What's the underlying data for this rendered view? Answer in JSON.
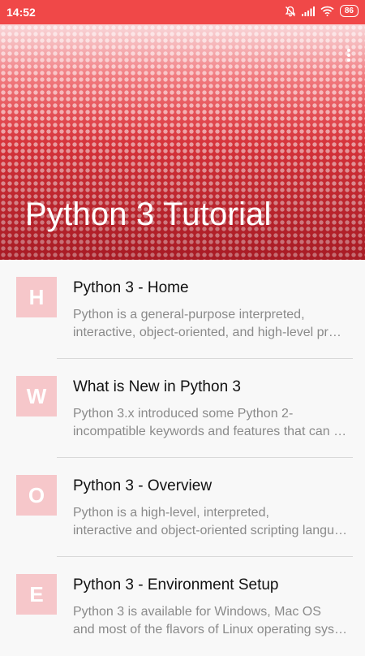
{
  "status_bar": {
    "time": "14:52",
    "battery": "86"
  },
  "header": {
    "title": "Python 3 Tutorial"
  },
  "items": [
    {
      "letter": "H",
      "title": "Python 3 - Home",
      "line1": "Python is a general-purpose interpreted,",
      "line2": "interactive, object-oriented, and high-level programming language."
    },
    {
      "letter": "W",
      "title": "What is New in Python 3",
      "line1": "Python 3.x introduced some Python 2-",
      "line2": "incompatible keywords and features that can be imported."
    },
    {
      "letter": "O",
      "title": "Python 3 - Overview",
      "line1": "Python is a high-level, interpreted,",
      "line2": "interactive and object-oriented scripting language."
    },
    {
      "letter": "E",
      "title": "Python 3 - Environment Setup",
      "line1": "Python 3 is available for Windows, Mac OS",
      "line2": "and most of the flavors of Linux operating system."
    }
  ]
}
